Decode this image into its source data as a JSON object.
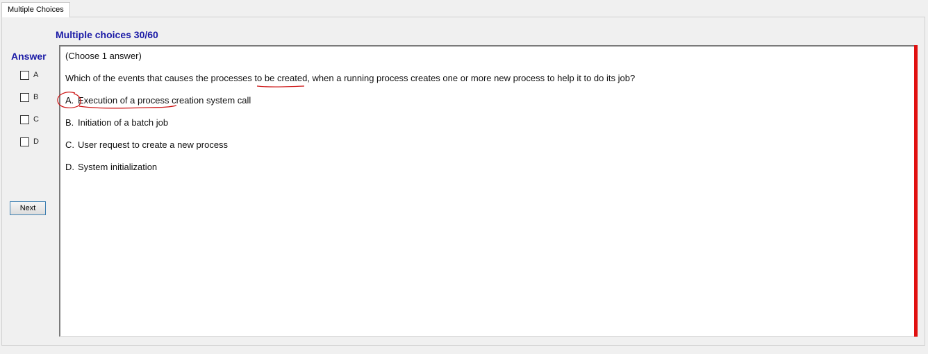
{
  "tab": {
    "label": "Multiple Choices"
  },
  "header": {
    "title": "Multiple choices 30/60"
  },
  "answer_panel": {
    "title": "Answer",
    "choices": [
      "A",
      "B",
      "C",
      "D"
    ],
    "next_label": "Next"
  },
  "question": {
    "instruction": "(Choose 1 answer)",
    "text": "Which of the events that causes the processes to be created, when a running process creates one or more new process to help it to do its job?",
    "options": [
      {
        "letter": "A.",
        "text": "Execution of a process creation system call"
      },
      {
        "letter": "B.",
        "text": "Initiation of a batch job"
      },
      {
        "letter": "C.",
        "text": "User request to create a new process"
      },
      {
        "letter": "D.",
        "text": "System initialization"
      }
    ]
  },
  "colors": {
    "heading_blue": "#1a1aa6",
    "annotation_red": "#cc1111",
    "scroll_bar_red": "#e01010"
  }
}
